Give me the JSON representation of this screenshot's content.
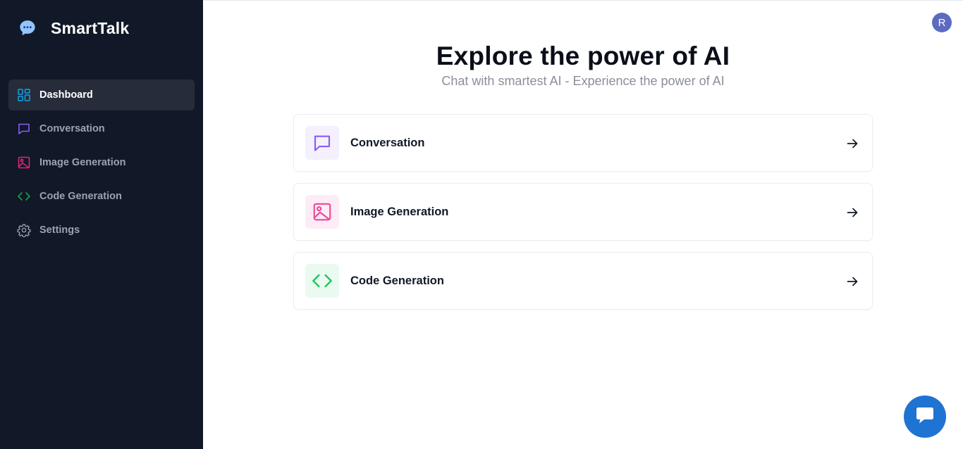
{
  "app": {
    "name": "SmartTalk",
    "brand_icon": "chat-bubble-icon"
  },
  "sidebar": {
    "items": [
      {
        "label": "Dashboard",
        "icon": "dashboard-icon",
        "color": "#0ea5e9",
        "active": true
      },
      {
        "label": "Conversation",
        "icon": "message-icon",
        "color": "#8b5cf6",
        "active": false
      },
      {
        "label": "Image Generation",
        "icon": "image-icon",
        "color": "#db2777",
        "active": false
      },
      {
        "label": "Code Generation",
        "icon": "code-icon",
        "color": "#16a34a",
        "active": false
      },
      {
        "label": "Settings",
        "icon": "gear-icon",
        "color": "#9ca3af",
        "active": false
      }
    ]
  },
  "header": {
    "avatar_initial": "R"
  },
  "hero": {
    "title": "Explore the power of AI",
    "subtitle": "Chat with smartest AI - Experience the power of AI"
  },
  "cards": [
    {
      "label": "Conversation",
      "icon": "message-icon",
      "color": "#8b5cf6",
      "bg": "#f4f0fe"
    },
    {
      "label": "Image Generation",
      "icon": "image-icon",
      "color": "#ec4899",
      "bg": "#fdecf5"
    },
    {
      "label": "Code Generation",
      "icon": "code-icon",
      "color": "#22c55e",
      "bg": "#eafaf0"
    }
  ],
  "chat_widget": {
    "icon": "chat-widget-icon",
    "color": "#1f73d2"
  }
}
